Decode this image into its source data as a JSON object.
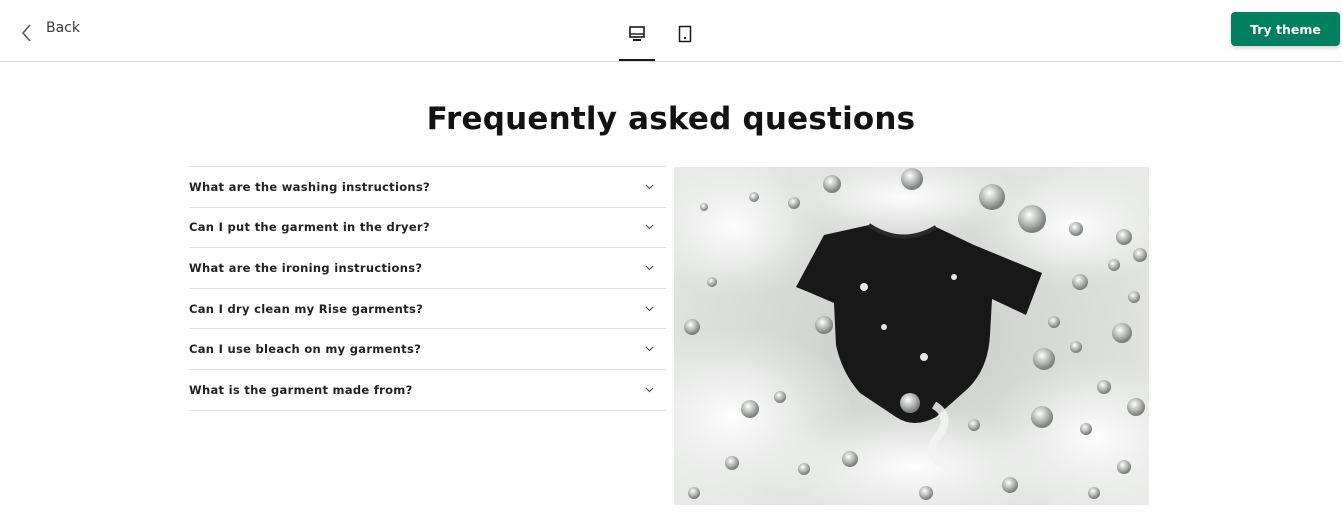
{
  "toolbar": {
    "back_label": "Back",
    "views": [
      {
        "name": "desktop",
        "icon": "desktop-icon",
        "active": true
      },
      {
        "name": "mobile",
        "icon": "mobile-icon",
        "active": false
      }
    ],
    "try_label": "Try theme",
    "accent_color": "#008060"
  },
  "faq": {
    "heading": "Frequently asked questions",
    "items": [
      {
        "question": "What are the washing instructions?"
      },
      {
        "question": "Can I put the garment in the dryer?"
      },
      {
        "question": "What are the ironing instructions?"
      },
      {
        "question": "Can I dry clean my Rise garments?"
      },
      {
        "question": "Can I use bleach on my garments?"
      },
      {
        "question": "What is the garment made from?"
      }
    ]
  },
  "image": {
    "subject": "black t-shirt in soapy water",
    "icon": "photo"
  }
}
